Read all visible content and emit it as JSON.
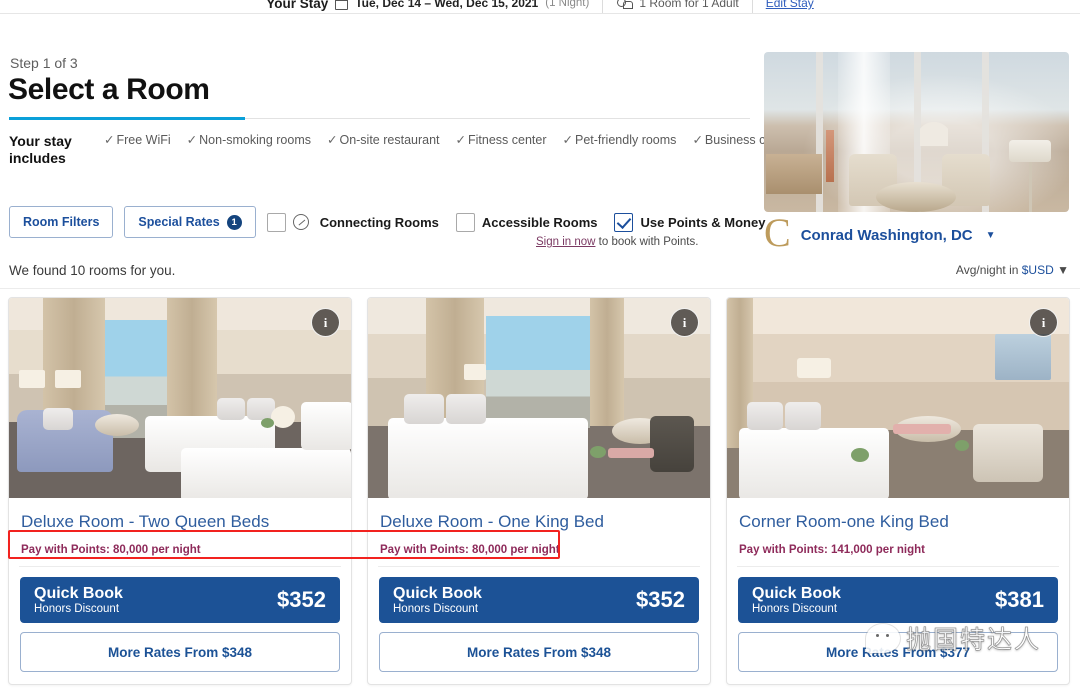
{
  "topbar": {
    "stay_label": "Your Stay",
    "dates": "Tue, Dec 14 – Wed, Dec 15, 2021",
    "nights": "(1 Night)",
    "guests": "1 Room for 1 Adult",
    "edit_link": "Edit Stay"
  },
  "header": {
    "step": "Step 1 of 3",
    "title": "Select a Room",
    "stay_includes_label": "Your stay includes",
    "amenities": [
      "Free WiFi",
      "Non-smoking rooms",
      "On-site restaurant",
      "Fitness center",
      "Pet-friendly rooms",
      "Business center"
    ]
  },
  "filters": {
    "room_filters": "Room Filters",
    "special_rates": "Special Rates",
    "special_rates_count": "1",
    "connecting_rooms": "Connecting Rooms",
    "accessible_rooms": "Accessible Rooms",
    "use_points_money": "Use Points & Money",
    "signin_link": "Sign in now",
    "signin_rest": " to book with Points."
  },
  "hotel": {
    "brand_initial": "C",
    "name": "Conrad Washington, DC",
    "caret": "▼"
  },
  "results": {
    "found_text": "We found 10 rooms for you.",
    "avg_prefix": "Avg/night in ",
    "avg_currency": "$USD",
    "avg_caret": "▼"
  },
  "cards": [
    {
      "info_badge": "i",
      "title": "Deluxe Room - Two Queen Beds",
      "points": "Pay with Points: 80,000 per night",
      "quick_book": "Quick Book",
      "honors": "Honors Discount",
      "price": "$352",
      "more_rates": "More Rates From $348"
    },
    {
      "info_badge": "i",
      "title": "Deluxe Room - One King Bed",
      "points": "Pay with Points: 80,000 per night",
      "quick_book": "Quick Book",
      "honors": "Honors Discount",
      "price": "$352",
      "more_rates": "More Rates From $348"
    },
    {
      "info_badge": "i",
      "title": "Corner Room-one King Bed",
      "points": "Pay with Points: 141,000 per night",
      "quick_book": "Quick Book",
      "honors": "Honors Discount",
      "price": "$381",
      "more_rates": "More Rates From $377"
    }
  ],
  "watermark": {
    "text": "抛国特达人"
  },
  "colors": {
    "accent_blue": "#0aa0d9",
    "brand_blue": "#1c5296",
    "link_blue": "#2f5d9e",
    "points_magenta": "#8e2a5a",
    "annotation_red": "#f2221f",
    "conrad_gold": "#bd9b5c"
  }
}
